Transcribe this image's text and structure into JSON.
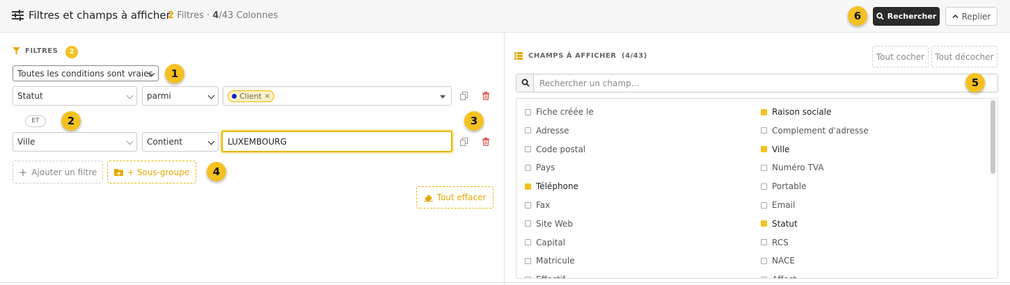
{
  "header": {
    "title": "Filtres et champs à afficher",
    "filters_count": "2",
    "filters_label": "Filtres",
    "separator": "·",
    "columns_selected": "4",
    "columns_total": "/43 Colonnes",
    "search_button": "Rechercher",
    "fold_button": "Replier"
  },
  "filters": {
    "section_title": "FILTRES",
    "count": "2",
    "mode_select": "Toutes les conditions sont vraies",
    "rows": [
      {
        "field": "Statut",
        "operator": "parmi",
        "value_chip": "Client"
      },
      {
        "field": "Ville",
        "operator": "Contient",
        "value": "LUXEMBOURG"
      }
    ],
    "conjunction": "ET",
    "add_filter": "Ajouter un filtre",
    "add_subgroup": "+ Sous-groupe",
    "clear_all": "Tout effacer"
  },
  "fields_panel": {
    "section_title": "CHAMPS À AFFICHER",
    "count": "(4/43)",
    "check_all": "Tout cocher",
    "uncheck_all": "Tout décocher",
    "search_placeholder": "Rechercher un champ...",
    "left": [
      {
        "label": "Fiche créée le",
        "checked": false
      },
      {
        "label": "Adresse",
        "checked": false
      },
      {
        "label": "Code postal",
        "checked": false
      },
      {
        "label": "Pays",
        "checked": false
      },
      {
        "label": "Téléphone",
        "checked": true
      },
      {
        "label": "Fax",
        "checked": false
      },
      {
        "label": "Site Web",
        "checked": false
      },
      {
        "label": "Capital",
        "checked": false
      },
      {
        "label": "Matricule",
        "checked": false
      },
      {
        "label": "Effectif",
        "checked": false
      }
    ],
    "right": [
      {
        "label": "Raison sociale",
        "checked": true
      },
      {
        "label": "Complement d'adresse",
        "checked": false
      },
      {
        "label": "Ville",
        "checked": true
      },
      {
        "label": "Numéro TVA",
        "checked": false
      },
      {
        "label": "Portable",
        "checked": false
      },
      {
        "label": "Email",
        "checked": false
      },
      {
        "label": "Statut",
        "checked": true
      },
      {
        "label": "RCS",
        "checked": false
      },
      {
        "label": "NACE",
        "checked": false
      },
      {
        "label": "Affect",
        "checked": false
      }
    ]
  },
  "callouts": [
    "1",
    "2",
    "3",
    "4",
    "5",
    "6"
  ],
  "colors": {
    "accent": "#f5c11f",
    "dark_button": "#2b2b2b",
    "chip_dot": "#1a22d0",
    "trash": "#d9534f"
  }
}
